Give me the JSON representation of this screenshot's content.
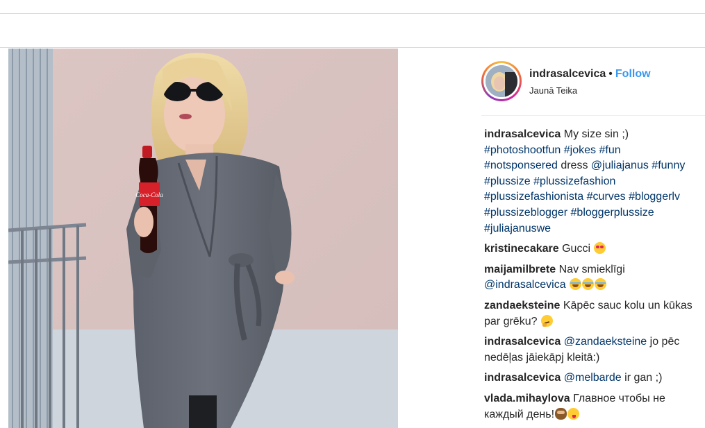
{
  "post": {
    "username": "indrasalcevica",
    "separator": "•",
    "follow_label": "Follow",
    "location": "Jaunā Teika"
  },
  "caption": {
    "author": "indrasalcevica",
    "text": "My size sin ;)",
    "hashtags_1": [
      "#photoshootfun",
      "#jokes",
      "#fun"
    ],
    "tag_notsponsered": "#notsponsered",
    "word_dress": "dress",
    "mention_juliajanus": "@juliajanus",
    "tag_funny": "#funny",
    "hashtags_2": [
      "#plussize",
      "#plussizefashion"
    ],
    "hashtags_3": [
      "#plussizefashionista",
      "#curves",
      "#bloggerlv"
    ],
    "hashtags_4": [
      "#plussizeblogger",
      "#bloggerplussize"
    ],
    "hashtags_5": [
      "#juliajanuswe"
    ]
  },
  "comments": [
    {
      "author": "kristinecakare",
      "text": "Gucci",
      "emojis": [
        "heart-eyes-emoji"
      ]
    },
    {
      "author": "maijamilbrete",
      "text": "Nav smieklīgi",
      "mention": "@indrasalcevica",
      "emojis": [
        "joy-emoji",
        "joy-emoji",
        "joy-emoji"
      ]
    },
    {
      "author": "zandaeksteine",
      "text": "Kāpēc sauc kolu un kūkas par grēku?",
      "emojis": [
        "thinking-emoji"
      ]
    },
    {
      "author": "indrasalcevica",
      "mention": "@zandaeksteine",
      "text": "jo pēc nedēļas jāiekāpj kleitā:)"
    },
    {
      "author": "indrasalcevica",
      "mention": "@melbarde",
      "text": "ir gan ;)"
    },
    {
      "author": "vlada.mihaylova",
      "text": "Главное чтобы не каждый день!",
      "emojis": [
        "see-no-evil-monkey-emoji",
        "yum-emoji"
      ]
    }
  ],
  "photo": {
    "bottle_label": "Coca-Cola"
  },
  "colors": {
    "link": "#3897f0",
    "hashtag": "#003569",
    "text": "#262626",
    "divider": "#efefef"
  }
}
